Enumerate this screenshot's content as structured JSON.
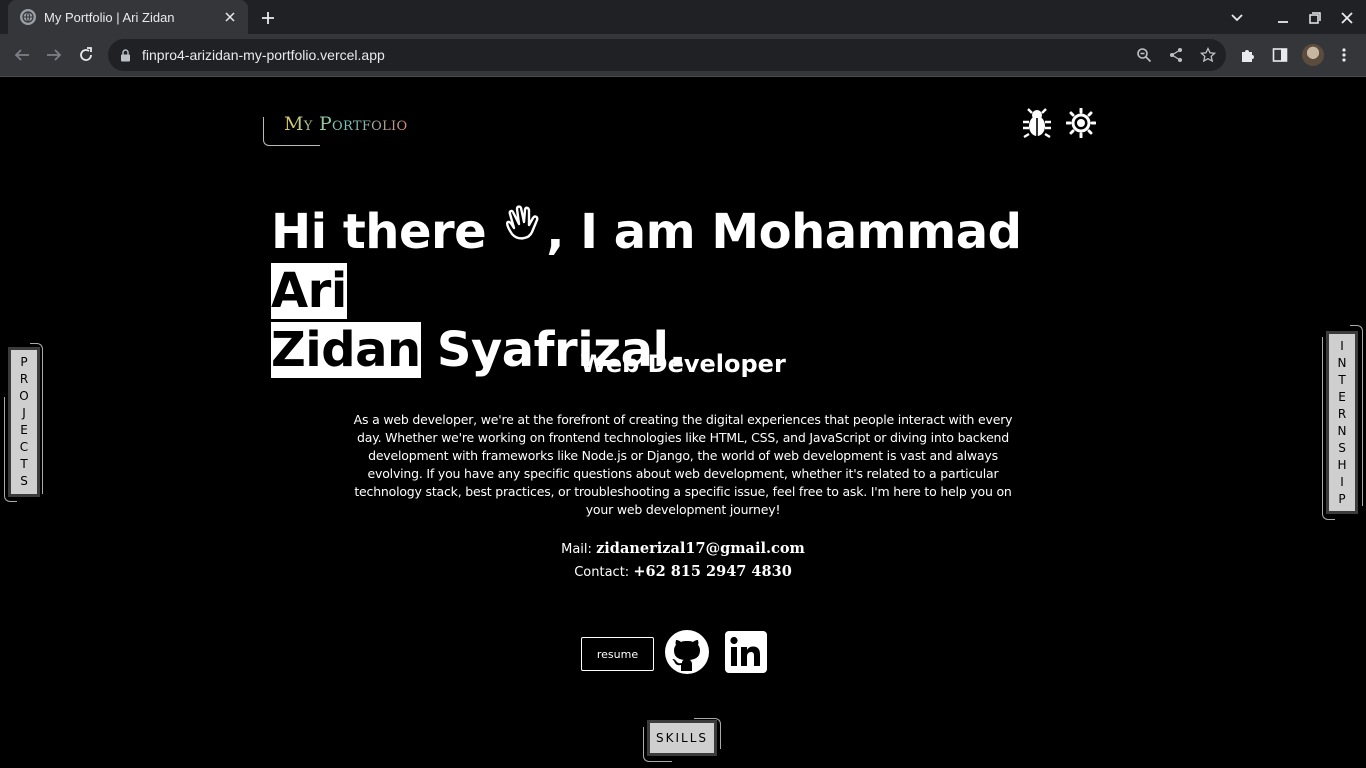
{
  "browser": {
    "tab_title": "My Portfolio | Ari Zidan",
    "url": "finpro4-arizidan-my-portfolio.vercel.app"
  },
  "page": {
    "logo": "My Portfolio",
    "headline": {
      "part1": "Hi there",
      "part2": ", I am Mohammad ",
      "highlight1": "Ari",
      "highlight2": "Zidan",
      "part3": " Syafrizal."
    },
    "role": "Web Developer",
    "bio": "As a web developer, we're at the forefront of creating the digital experiences that people interact with every day. Whether we're working on frontend technologies like HTML, CSS, and JavaScript or diving into backend development with frameworks like Node.js or Django, the world of web development is vast and always evolving. If you have any specific questions about web development, whether it's related to a particular technology stack, best practices, or troubleshooting a specific issue, feel free to ask. I'm here to help you on your web development journey!",
    "mail_label": "Mail:",
    "mail_value": "zidanerizal17@gmail.com",
    "contact_label": "Contact:",
    "contact_value": "+62 815 2947 4830",
    "resume_label": "resume",
    "side_left": [
      "P",
      "R",
      "O",
      "J",
      "E",
      "C",
      "T",
      "S"
    ],
    "side_right": [
      "I",
      "N",
      "T",
      "E",
      "R",
      "N",
      "S",
      "H",
      "I",
      "P"
    ],
    "skills_label": "SKILLS"
  },
  "colors": {
    "background": "#000000",
    "chrome_dark": "#202124",
    "chrome_mid": "#35363a",
    "tab_fill": "#cfcfcf"
  }
}
